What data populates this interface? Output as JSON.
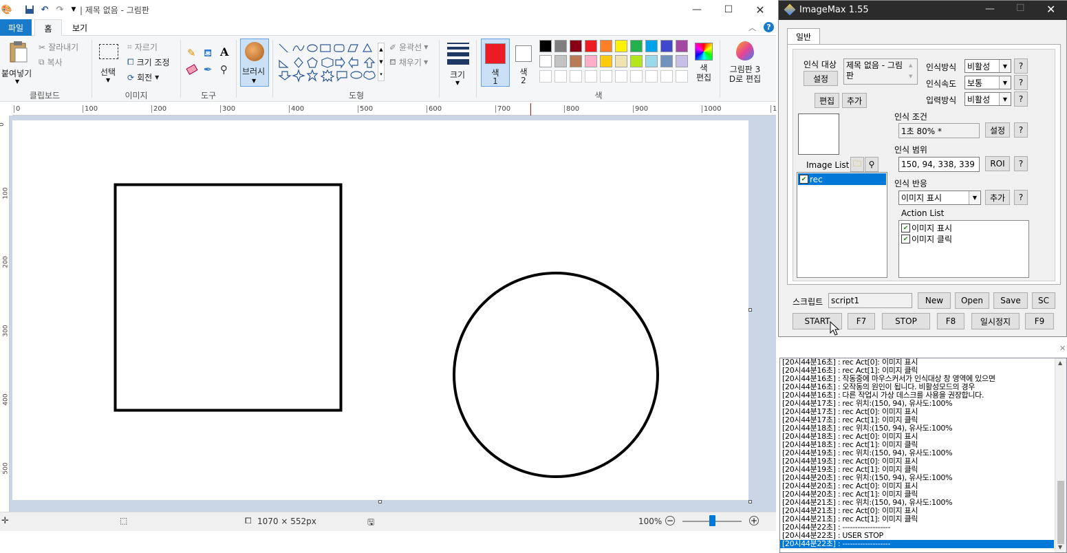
{
  "paint": {
    "window_title": "| 제목 없음 - 그림판",
    "tabs": [
      "파일",
      "홈",
      "보기"
    ],
    "clipboard": {
      "paste": "붙여넣기",
      "cut": "잘라내기",
      "copy": "복사",
      "group": "클립보드"
    },
    "image": {
      "select": "선택",
      "crop": "자르기",
      "resize": "크기 조정",
      "rotate": "회전",
      "group": "이미지"
    },
    "tools": {
      "group": "도구",
      "text_glyph": "A"
    },
    "brush": {
      "label": "브러시"
    },
    "shapes": {
      "outline": "윤곽선",
      "fill": "채우기",
      "group": "도형"
    },
    "size": {
      "label": "크기"
    },
    "color1": {
      "label": "색",
      "num": "1",
      "value": "#ed1c24"
    },
    "color2": {
      "label": "색",
      "num": "2",
      "value": "#ffffff"
    },
    "colors_group": "색",
    "edit_colors": "색\n편집",
    "paint3d": "그림판 3\nD로 편집",
    "palette_row1": [
      "#000000",
      "#7f7f7f",
      "#880015",
      "#ed1c24",
      "#ff7f27",
      "#fff200",
      "#22b14c",
      "#00a2e8",
      "#3f48cc",
      "#a349a4"
    ],
    "palette_row2": [
      "#ffffff",
      "#c3c3c3",
      "#b97a57",
      "#ffaec9",
      "#ffc90e",
      "#efe4b0",
      "#b5e61d",
      "#99d9ea",
      "#7092be",
      "#c8bfe7"
    ],
    "ruler_labels": [
      "0",
      "100",
      "200",
      "300",
      "400",
      "500",
      "600",
      "700",
      "800",
      "900",
      "1000",
      "1"
    ],
    "vruler_labels": [
      "0",
      "100",
      "200",
      "300",
      "400",
      "500"
    ],
    "status": {
      "dimensions": "1070 × 552px",
      "zoom": "100%"
    }
  },
  "imagemax": {
    "title": "ImageMax 1.55",
    "tab": "일반",
    "target_label": "인식 대상",
    "target_value": "제목 없음 - 그림판",
    "set_button": "설정",
    "edit_button": "편집",
    "add_button": "추가",
    "recog_method_label": "인식방식",
    "recog_method_value": "비활성",
    "recog_speed_label": "인식속도",
    "recog_speed_value": "보통",
    "input_method_label": "입력방식",
    "input_method_value": "비활성",
    "help": "?",
    "condition_label": "인식 조건",
    "condition_value": "1초 80% *",
    "range_label": "인식 범위",
    "range_value": "150, 94, 338, 339",
    "roi_button": "ROI",
    "reaction_label": "인식 반응",
    "reaction_value": "이미지 표시",
    "image_list_label": "Image List",
    "image_list_items": [
      "rec"
    ],
    "action_list_label": "Action List",
    "action_list_items": [
      "이미지 표시",
      "이미지 클릭"
    ],
    "script_label": "스크립트",
    "script_value": "script1",
    "new_button": "New",
    "open_button": "Open",
    "save_button": "Save",
    "sc_button": "SC",
    "start_button": "START",
    "f7": "F7",
    "stop_button": "STOP",
    "f8": "F8",
    "pause_button": "일시정지",
    "f9": "F9"
  },
  "log": [
    "[20시44분16초] : rec Act[0]: 이미지 표시",
    "[20시44분16초] : rec Act[1]: 이미지 클릭",
    "[20시44분16초] : 작동중에 마우스커서가 인식대상 창 영역에 있으면",
    "[20시44분16초] : 오작동의 원인이 됩니다. 비활성모드의 경우",
    "[20시44분16초] : 다른 작업시 가상 데스크를 사용을 권장합니다.",
    "[20시44분17초] : rec 위치:(150, 94), 유사도:100%",
    "[20시44분17초] : rec Act[0]: 이미지 표시",
    "[20시44분17초] : rec Act[1]: 이미지 클릭",
    "[20시44분18초] : rec 위치:(150, 94), 유사도:100%",
    "[20시44분18초] : rec Act[0]: 이미지 표시",
    "[20시44분18초] : rec Act[1]: 이미지 클릭",
    "[20시44분19초] : rec 위치:(150, 94), 유사도:100%",
    "[20시44분19초] : rec Act[0]: 이미지 표시",
    "[20시44분19초] : rec Act[1]: 이미지 클릭",
    "[20시44분20초] : rec 위치:(150, 94), 유사도:100%",
    "[20시44분20초] : rec Act[0]: 이미지 표시",
    "[20시44분20초] : rec Act[1]: 이미지 클릭",
    "[20시44분21초] : rec 위치:(150, 94), 유사도:100%",
    "[20시44분21초] : rec Act[0]: 이미지 표시",
    "[20시44분21초] : rec Act[1]: 이미지 클릭",
    "[20시44분22초] : -------------------",
    "[20시44분22초] :     USER STOP",
    "[20시44분22초] : -------------------"
  ]
}
